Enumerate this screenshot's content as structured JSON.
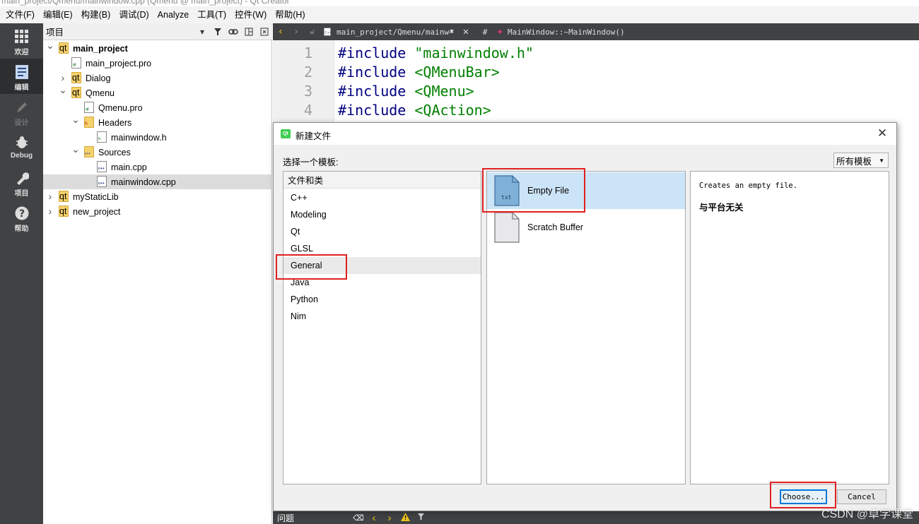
{
  "window": {
    "title": "main_project/Qmenu/mainwindow.cpp (Qmenu @ main_project) - Qt Creator"
  },
  "menubar": [
    "文件(F)",
    "编辑(E)",
    "构建(B)",
    "调试(D)",
    "Analyze",
    "工具(T)",
    "控件(W)",
    "帮助(H)"
  ],
  "modes": [
    {
      "label": "欢迎",
      "icon": "grid-icon",
      "active": false,
      "enabled": true
    },
    {
      "label": "编辑",
      "icon": "document-edit-icon",
      "active": true,
      "enabled": true
    },
    {
      "label": "设计",
      "icon": "pencil-icon",
      "active": false,
      "enabled": false
    },
    {
      "label": "Debug",
      "icon": "bug-icon",
      "active": false,
      "enabled": true
    },
    {
      "label": "项目",
      "icon": "wrench-icon",
      "active": false,
      "enabled": true
    },
    {
      "label": "帮助",
      "icon": "help-icon",
      "active": false,
      "enabled": true
    }
  ],
  "project_panel": {
    "title": "项目",
    "tree": [
      {
        "label": "main_project",
        "level": 0,
        "expander": "open",
        "icon": "folder-icon",
        "bold": true
      },
      {
        "label": "main_project.pro",
        "level": 1,
        "expander": "none",
        "icon": "pro-file-icon"
      },
      {
        "label": "Dialog",
        "level": 1,
        "expander": "closed",
        "icon": "folder-icon"
      },
      {
        "label": "Qmenu",
        "level": 1,
        "expander": "open",
        "icon": "folder-icon"
      },
      {
        "label": "Qmenu.pro",
        "level": 2,
        "expander": "none",
        "icon": "pro-file-icon"
      },
      {
        "label": "Headers",
        "level": 2,
        "expander": "open",
        "icon": "header-folder-icon"
      },
      {
        "label": "mainwindow.h",
        "level": 3,
        "expander": "none",
        "icon": "header-file-icon"
      },
      {
        "label": "Sources",
        "level": 2,
        "expander": "open",
        "icon": "source-folder-icon"
      },
      {
        "label": "main.cpp",
        "level": 3,
        "expander": "none",
        "icon": "cpp-file-icon"
      },
      {
        "label": "mainwindow.cpp",
        "level": 3,
        "expander": "none",
        "icon": "cpp-file-icon",
        "selected": true
      },
      {
        "label": "myStaticLib",
        "level": 0,
        "expander": "closed",
        "icon": "folder-icon"
      },
      {
        "label": "new_project",
        "level": 0,
        "expander": "closed",
        "icon": "folder-icon"
      }
    ]
  },
  "editor": {
    "file_path": "main_project/Qmenu/mainw⋯",
    "hash": "#",
    "symbol": "MainWindow::~MainWindow()",
    "lines": [
      {
        "num": "1",
        "kw": "#include",
        "arg": "\"mainwindow.h\""
      },
      {
        "num": "2",
        "kw": "#include",
        "arg": "<QMenuBar>"
      },
      {
        "num": "3",
        "kw": "#include",
        "arg": "<QMenu>"
      },
      {
        "num": "4",
        "kw": "#include",
        "arg": "<QAction>"
      }
    ]
  },
  "dialog": {
    "title": "新建文件",
    "choose_label": "选择一个模板:",
    "filter_value": "所有模板",
    "categories_header": "文件和类",
    "categories": [
      "C++",
      "Modeling",
      "Qt",
      "GLSL",
      "General",
      "Java",
      "Python",
      "Nim"
    ],
    "selected_category": "General",
    "templates": [
      {
        "name": "Empty File",
        "icon_tag": "txt",
        "selected": true
      },
      {
        "name": "Scratch Buffer",
        "icon_tag": "",
        "selected": false
      }
    ],
    "description": "Creates an empty file.",
    "platform": "与平台无关",
    "choose_button": "Choose...",
    "cancel_button": "Cancel"
  },
  "bottombar": {
    "issues_label": "问题"
  },
  "watermark": "CSDN @卓学课堂",
  "colors": {
    "highlight_box": "#e02020",
    "selection": "#cce4f7",
    "dark_bar": "#404244"
  }
}
